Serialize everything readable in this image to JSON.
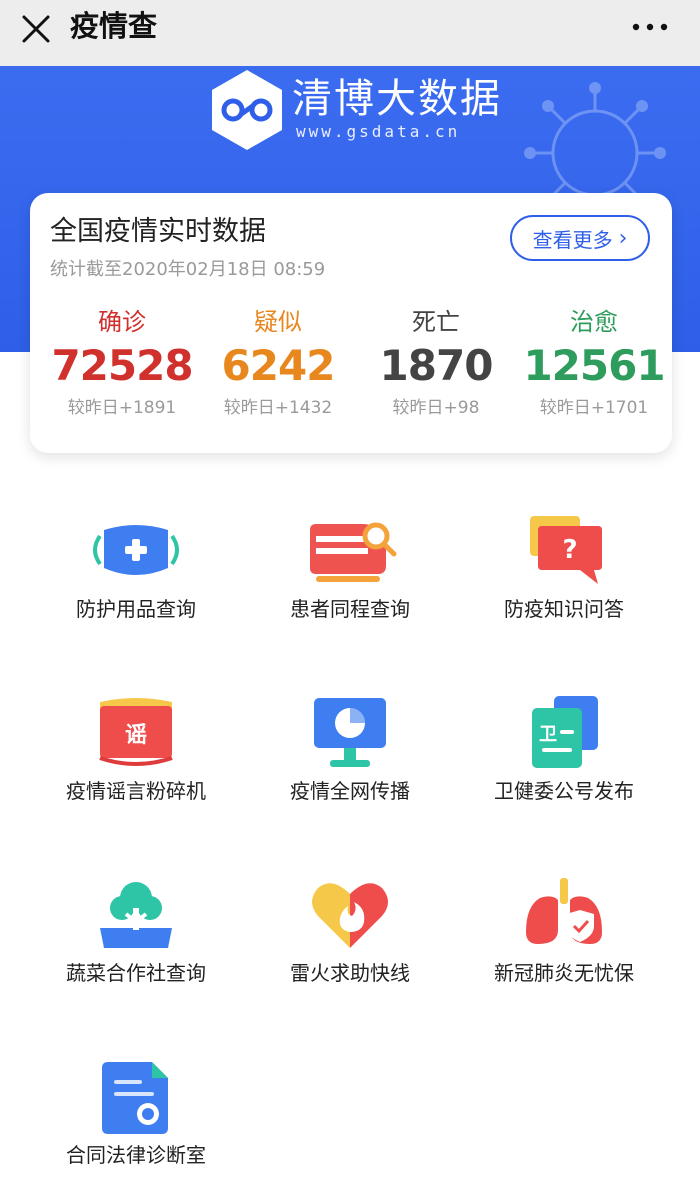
{
  "topbar": {
    "title": "疫情查"
  },
  "banner": {
    "brand_name": "清博大数据",
    "brand_url": "www.gsdata.cn"
  },
  "card": {
    "title": "全国疫情实时数据",
    "subtitle": "统计截至2020年02月18日 08:59",
    "see_more": "查看更多",
    "stats": [
      {
        "label": "确诊",
        "value": "72528",
        "delta": "较昨日+1891",
        "color": "#d0312d"
      },
      {
        "label": "疑似",
        "value": "6242",
        "delta": "较昨日+1432",
        "color": "#e8871e"
      },
      {
        "label": "死亡",
        "value": "1870",
        "delta": "较昨日+98",
        "color": "#444444"
      },
      {
        "label": "治愈",
        "value": "12561",
        "delta": "较昨日+1701",
        "color": "#2e9c5c"
      }
    ]
  },
  "services": [
    {
      "label": "防护用品查询",
      "icon": "mask-icon"
    },
    {
      "label": "患者同程查询",
      "icon": "train-search-icon"
    },
    {
      "label": "防疫知识问答",
      "icon": "question-chat-icon"
    },
    {
      "label": "疫情谣言粉碎机",
      "icon": "rumor-book-icon"
    },
    {
      "label": "疫情全网传播",
      "icon": "monitor-chart-icon"
    },
    {
      "label": "卫健委公号发布",
      "icon": "health-doc-icon"
    },
    {
      "label": "蔬菜合作社查询",
      "icon": "vegetable-tree-icon"
    },
    {
      "label": "雷火求助快线",
      "icon": "heart-fire-icon"
    },
    {
      "label": "新冠肺炎无忧保",
      "icon": "lungs-shield-icon"
    },
    {
      "label": "合同法律诊断室",
      "icon": "contract-doc-icon"
    }
  ]
}
